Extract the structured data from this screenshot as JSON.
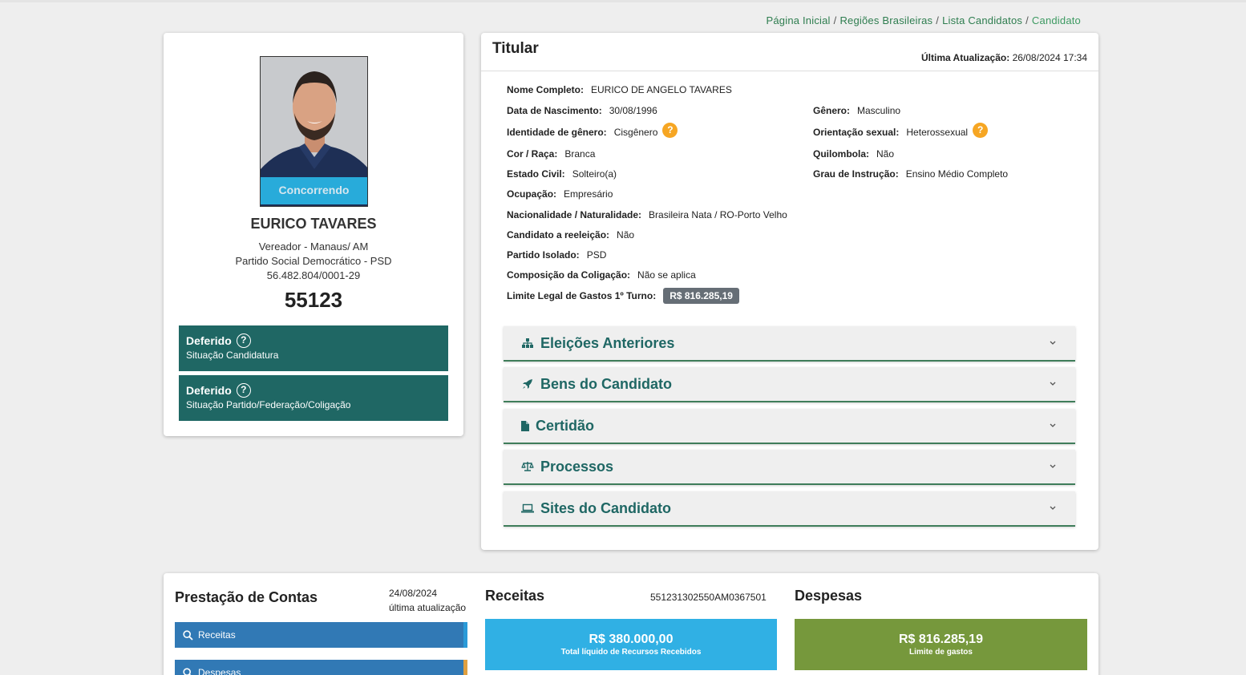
{
  "breadcrumb": {
    "items": [
      "Página Inicial",
      "Regiões Brasileiras",
      "Lista Candidatos"
    ],
    "current": "Candidato",
    "separator": "/"
  },
  "profile": {
    "photo_status": "Concorrendo",
    "name": "EURICO TAVARES",
    "role": "Vereador - Manaus/ AM",
    "party": "Partido Social Democrático - PSD",
    "cnpj": "56.482.804/0001-29",
    "number": "55123",
    "situations": [
      {
        "title": "Deferido",
        "subtitle": "Situação Candidatura"
      },
      {
        "title": "Deferido",
        "subtitle": "Situação Partido/Federação/Coligação"
      }
    ],
    "help_glyph": "?"
  },
  "titular": {
    "title": "Titular",
    "update_label": "Última Atualização:",
    "update_value": "26/08/2024 17:34",
    "fields": {
      "nome": {
        "label": "Nome Completo:",
        "value": "EURICO DE ANGELO TAVARES"
      },
      "nascimento": {
        "label": "Data de Nascimento:",
        "value": "30/08/1996"
      },
      "genero": {
        "label": "Gênero:",
        "value": "Masculino"
      },
      "identidade": {
        "label": "Identidade de gênero:",
        "value": "Cisgênero"
      },
      "orientacao": {
        "label": "Orientação sexual:",
        "value": "Heterossexual"
      },
      "cor": {
        "label": "Cor / Raça:",
        "value": "Branca"
      },
      "quilombola": {
        "label": "Quilombola:",
        "value": "Não"
      },
      "estado_civil": {
        "label": "Estado Civil:",
        "value": "Solteiro(a)"
      },
      "instrucao": {
        "label": "Grau de Instrução:",
        "value": "Ensino Médio Completo"
      },
      "ocupacao": {
        "label": "Ocupação:",
        "value": "Empresário"
      },
      "nacionalidade": {
        "label": "Nacionalidade / Naturalidade:",
        "value": "Brasileira Nata / RO-Porto Velho"
      },
      "reeleicao": {
        "label": "Candidato a reeleição:",
        "value": "Não"
      },
      "partido": {
        "label": "Partido Isolado:",
        "value": "PSD"
      },
      "coligacao": {
        "label": "Composição da Coligação:",
        "value": "Não se aplica"
      },
      "limite": {
        "label": "Limite Legal de Gastos 1º Turno:",
        "value": "R$ 816.285,19"
      }
    },
    "help_glyph": "?",
    "accordions": [
      {
        "label": "Eleições Anteriores",
        "icon": "sitemap-icon"
      },
      {
        "label": "Bens do Candidato",
        "icon": "rocket-icon"
      },
      {
        "label": "Certidão",
        "icon": "file-icon"
      },
      {
        "label": "Processos",
        "icon": "balance-scale-icon"
      },
      {
        "label": "Sites do Candidato",
        "icon": "laptop-icon"
      }
    ]
  },
  "contas": {
    "title": "Prestação de Contas",
    "date": "24/08/2024",
    "date_label": "última atualização",
    "buttons": {
      "receitas": "Receitas",
      "despesas": "Despesas"
    },
    "receitas": {
      "title": "Receitas",
      "code": "551231302550AM0367501",
      "value": "R$ 380.000,00",
      "desc": "Total líquido de Recursos Recebidos",
      "color": "#30b0e4"
    },
    "despesas": {
      "title": "Despesas",
      "value": "R$ 816.285,19",
      "desc": "Limite de gastos",
      "color": "#76983c"
    }
  },
  "colors": {
    "accent_green": "#1f6764",
    "link_green": "#2e7d4f",
    "help_orange": "#f6a623",
    "blue_button": "#3179b5"
  }
}
